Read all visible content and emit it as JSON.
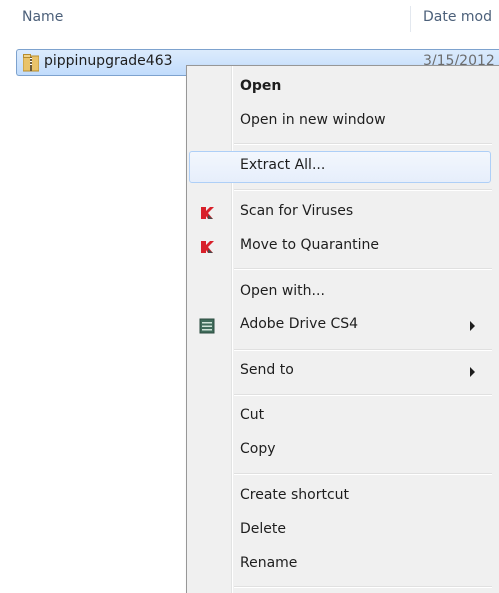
{
  "header": {
    "name_label": "Name",
    "date_label": "Date mod"
  },
  "file": {
    "name": "pippinupgrade463",
    "date": "3/15/2012"
  },
  "menu": {
    "open": "Open",
    "open_new_window": "Open in new window",
    "extract_all": "Extract All...",
    "scan_viruses": "Scan for Viruses",
    "move_quarantine": "Move to Quarantine",
    "open_with": "Open with...",
    "adobe_drive": "Adobe Drive CS4",
    "send_to": "Send to",
    "cut": "Cut",
    "copy": "Copy",
    "create_shortcut": "Create shortcut",
    "delete": "Delete",
    "rename": "Rename"
  },
  "icons": {
    "file": "zip-folder-icon",
    "scan": "kaspersky-icon",
    "quarantine": "kaspersky-icon",
    "adobe": "adobe-drive-icon",
    "submenu": "chevron-right-icon"
  },
  "colors": {
    "kaspersky_red": "#d8202a",
    "selection_border": "#7da2ce",
    "hover_border": "#aecff7"
  }
}
